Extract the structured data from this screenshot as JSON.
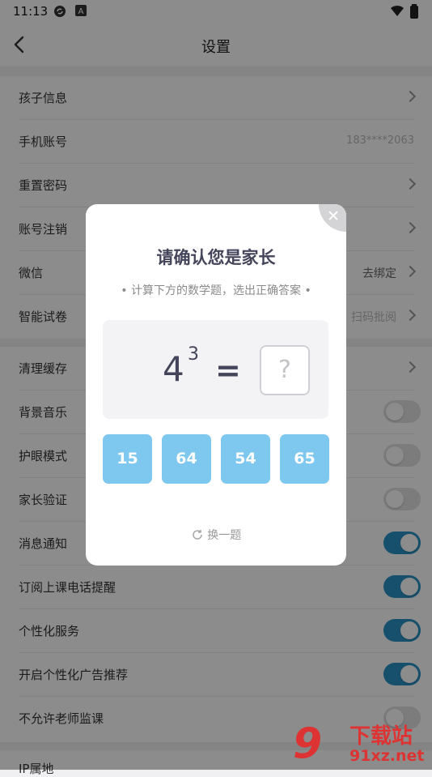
{
  "status_bar": {
    "time": "11:13",
    "icons": [
      "sync-icon",
      "a-badge-icon",
      "wifi-icon",
      "battery-icon"
    ]
  },
  "header": {
    "title": "设置"
  },
  "settings": {
    "rows": [
      {
        "label": "孩子信息"
      },
      {
        "label": "手机账号",
        "value": "183****2063"
      },
      {
        "label": "重置密码"
      },
      {
        "label": "账号注销"
      },
      {
        "label": "微信",
        "value": "去绑定"
      },
      {
        "label": "智能试卷",
        "value": "扫码批阅"
      },
      {
        "label": "清理缓存"
      },
      {
        "label": "背景音乐",
        "toggle": false
      },
      {
        "label": "护眼模式",
        "toggle": false
      },
      {
        "label": "家长验证",
        "toggle": false
      },
      {
        "label": "消息通知",
        "toggle": true
      },
      {
        "label": "订阅上课电话提醒",
        "toggle": true
      },
      {
        "label": "个性化服务",
        "toggle": true
      },
      {
        "label": "开启个性化广告推荐",
        "toggle": true
      },
      {
        "label": "不允许老师监课",
        "toggle": false
      },
      {
        "label": "IP属地"
      }
    ]
  },
  "modal": {
    "title": "请确认您是家长",
    "subtitle": "• 计算下方的数学题，选出正确答案 •",
    "question": {
      "base": "4",
      "exponent": "3",
      "equals": "=",
      "answer": "?"
    },
    "options": [
      "15",
      "64",
      "54",
      "65"
    ],
    "refresh_label": "换一题",
    "close_symbol": "✕"
  },
  "watermark": {
    "number": "9",
    "text1": "下载站",
    "text2": "91xz.net"
  },
  "colors": {
    "accent": "#2a93c7",
    "option": "#7ec7ef"
  }
}
